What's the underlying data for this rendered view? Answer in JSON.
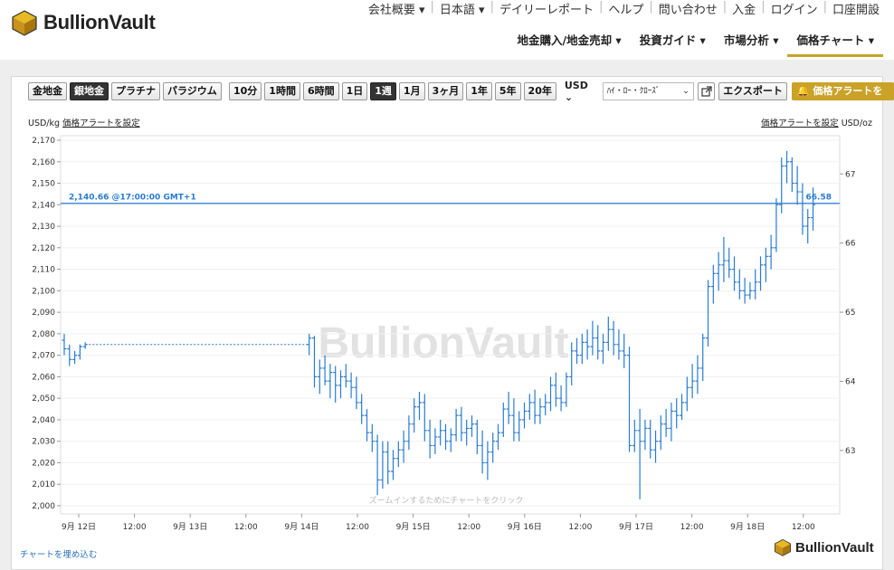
{
  "header": {
    "logo_text": "BullionVault",
    "top_links": [
      "会社概要 ▾",
      "日本語 ▾",
      "デイリーレポート",
      "ヘルプ",
      "問い合わせ",
      "入金",
      "ログイン",
      "口座開設"
    ],
    "nav": [
      {
        "label": "地金購入/地金売却 ▾",
        "active": false
      },
      {
        "label": "投資ガイド ▾",
        "active": false
      },
      {
        "label": "市場分析 ▾",
        "active": false
      },
      {
        "label": "価格チャート ▾",
        "active": true
      }
    ]
  },
  "toolbar": {
    "metals": [
      {
        "label": "金地金",
        "selected": false
      },
      {
        "label": "銀地金",
        "selected": true
      },
      {
        "label": "プラチナ",
        "selected": false
      },
      {
        "label": "パラジウム",
        "selected": false
      }
    ],
    "ranges": [
      {
        "label": "10分",
        "selected": false
      },
      {
        "label": "1時間",
        "selected": false
      },
      {
        "label": "6時間",
        "selected": false
      },
      {
        "label": "1日",
        "selected": false
      },
      {
        "label": "1週",
        "selected": true
      },
      {
        "label": "1月",
        "selected": false
      },
      {
        "label": "3ヶ月",
        "selected": false
      },
      {
        "label": "1年",
        "selected": false
      },
      {
        "label": "5年",
        "selected": false
      },
      {
        "label": "20年",
        "selected": false
      }
    ],
    "currency": "USD",
    "chart_style": "ﾊｲ・ﾛｰ・ｸﾛｰｽﾞ",
    "export_label": "エクスポート",
    "alert_label": "価格アラートを設定"
  },
  "units": {
    "left_unit": "USD/kg",
    "left_link": "価格アラートを設定",
    "right_link": "価格アラートを設定",
    "right_unit": "USD/oz"
  },
  "embed_label": "チャートを埋め込む",
  "footer_logo": "BullionVault",
  "colors": {
    "accent": "#c9a227",
    "series": "#2a7bd4",
    "dark": "#333333"
  },
  "chart_data": {
    "type": "ohlc",
    "watermark": "BullionVault",
    "zoom_hint": "ズームインするためにチャートをクリック",
    "current_label": "2,140.66 @17:00:00 GMT+1",
    "current_value": 2140.66,
    "current_value_oz": "66.58",
    "ylim": [
      2000,
      2170
    ],
    "yticks": [
      "2,000",
      "2,010",
      "2,020",
      "2,030",
      "2,040",
      "2,050",
      "2,060",
      "2,070",
      "2,080",
      "2,090",
      "2,100",
      "2,110",
      "2,120",
      "2,130",
      "2,140",
      "2,150",
      "2,160",
      "2,170"
    ],
    "yticks_right": [
      "63",
      "64",
      "65",
      "66",
      "67"
    ],
    "xticks": [
      "9月 12日",
      "12:00",
      "9月 13日",
      "12:00",
      "9月 14日",
      "12:00",
      "9月 15日",
      "12:00",
      "9月 16日",
      "12:00",
      "9月 17日",
      "12:00",
      "9月 18日",
      "12:00"
    ],
    "series": [
      {
        "name": "",
        "color": "#2a7bd4",
        "data": [
          [
            0.0,
            2077,
            2080,
            2070,
            2073
          ],
          [
            0.15,
            2073,
            2075,
            2065,
            2068
          ],
          [
            0.3,
            2068,
            2072,
            2066,
            2070
          ],
          [
            0.45,
            2070,
            2075,
            2068,
            2074
          ],
          [
            0.6,
            2074,
            2076,
            2073,
            2075
          ],
          [
            7.0,
            2075,
            2080,
            2070,
            2078
          ],
          [
            7.15,
            2078,
            2079,
            2055,
            2060
          ],
          [
            7.3,
            2060,
            2068,
            2052,
            2064
          ],
          [
            7.45,
            2064,
            2070,
            2056,
            2058
          ],
          [
            7.6,
            2058,
            2066,
            2050,
            2062
          ],
          [
            7.75,
            2062,
            2065,
            2048,
            2056
          ],
          [
            7.9,
            2056,
            2063,
            2050,
            2060
          ],
          [
            8.05,
            2060,
            2066,
            2055,
            2058
          ],
          [
            8.2,
            2058,
            2062,
            2050,
            2055
          ],
          [
            8.35,
            2055,
            2060,
            2045,
            2048
          ],
          [
            8.5,
            2048,
            2052,
            2038,
            2042
          ],
          [
            8.65,
            2042,
            2045,
            2030,
            2034
          ],
          [
            8.8,
            2034,
            2038,
            2025,
            2030
          ],
          [
            8.95,
            2030,
            2033,
            2005,
            2012
          ],
          [
            9.1,
            2012,
            2030,
            2008,
            2025
          ],
          [
            9.25,
            2025,
            2030,
            2010,
            2016
          ],
          [
            9.4,
            2016,
            2026,
            2012,
            2022
          ],
          [
            9.55,
            2022,
            2030,
            2018,
            2026
          ],
          [
            9.7,
            2026,
            2035,
            2020,
            2030
          ],
          [
            9.85,
            2030,
            2042,
            2026,
            2038
          ],
          [
            10.0,
            2038,
            2050,
            2034,
            2046
          ],
          [
            10.15,
            2046,
            2053,
            2040,
            2048
          ],
          [
            10.3,
            2048,
            2052,
            2030,
            2035
          ],
          [
            10.45,
            2035,
            2040,
            2022,
            2028
          ],
          [
            10.6,
            2028,
            2036,
            2024,
            2032
          ],
          [
            10.75,
            2032,
            2040,
            2028,
            2035
          ],
          [
            10.9,
            2035,
            2038,
            2026,
            2030
          ],
          [
            11.05,
            2030,
            2036,
            2025,
            2033
          ],
          [
            11.2,
            2033,
            2045,
            2030,
            2042
          ],
          [
            11.35,
            2042,
            2046,
            2030,
            2034
          ],
          [
            11.5,
            2034,
            2040,
            2028,
            2036
          ],
          [
            11.65,
            2036,
            2042,
            2032,
            2038
          ],
          [
            11.8,
            2038,
            2040,
            2024,
            2028
          ],
          [
            11.95,
            2028,
            2035,
            2015,
            2020
          ],
          [
            12.1,
            2020,
            2030,
            2012,
            2025
          ],
          [
            12.25,
            2025,
            2034,
            2020,
            2030
          ],
          [
            12.4,
            2030,
            2038,
            2026,
            2034
          ],
          [
            12.55,
            2034,
            2048,
            2032,
            2045
          ],
          [
            12.7,
            2045,
            2053,
            2038,
            2042
          ],
          [
            12.85,
            2042,
            2050,
            2030,
            2034
          ],
          [
            13.0,
            2034,
            2044,
            2030,
            2040
          ],
          [
            13.15,
            2040,
            2048,
            2036,
            2044
          ],
          [
            13.3,
            2044,
            2052,
            2040,
            2048
          ],
          [
            13.45,
            2048,
            2054,
            2038,
            2042
          ],
          [
            13.6,
            2042,
            2050,
            2038,
            2046
          ],
          [
            13.75,
            2046,
            2052,
            2042,
            2048
          ],
          [
            13.9,
            2048,
            2060,
            2044,
            2056
          ],
          [
            14.05,
            2056,
            2062,
            2046,
            2050
          ],
          [
            14.2,
            2050,
            2056,
            2044,
            2048
          ],
          [
            14.35,
            2048,
            2062,
            2046,
            2060
          ],
          [
            14.5,
            2060,
            2076,
            2056,
            2072
          ],
          [
            14.65,
            2072,
            2078,
            2066,
            2070
          ],
          [
            14.8,
            2070,
            2080,
            2066,
            2076
          ],
          [
            14.95,
            2076,
            2082,
            2068,
            2074
          ],
          [
            15.1,
            2074,
            2086,
            2070,
            2078
          ],
          [
            15.25,
            2078,
            2084,
            2068,
            2072
          ],
          [
            15.4,
            2072,
            2080,
            2066,
            2076
          ],
          [
            15.55,
            2076,
            2088,
            2072,
            2082
          ],
          [
            15.7,
            2082,
            2086,
            2070,
            2075
          ],
          [
            15.85,
            2075,
            2082,
            2068,
            2072
          ],
          [
            16.0,
            2072,
            2080,
            2064,
            2070
          ],
          [
            16.15,
            2070,
            2074,
            2025,
            2028
          ],
          [
            16.3,
            2028,
            2040,
            2025,
            2035
          ],
          [
            16.45,
            2035,
            2045,
            2003,
            2030
          ],
          [
            16.6,
            2030,
            2040,
            2026,
            2036
          ],
          [
            16.75,
            2036,
            2040,
            2022,
            2026
          ],
          [
            16.9,
            2026,
            2035,
            2020,
            2030
          ],
          [
            17.05,
            2030,
            2042,
            2026,
            2038
          ],
          [
            17.2,
            2038,
            2045,
            2032,
            2036
          ],
          [
            17.35,
            2036,
            2048,
            2030,
            2044
          ],
          [
            17.5,
            2044,
            2050,
            2036,
            2042
          ],
          [
            17.65,
            2042,
            2052,
            2040,
            2048
          ],
          [
            17.8,
            2048,
            2060,
            2044,
            2055
          ],
          [
            17.95,
            2055,
            2066,
            2050,
            2058
          ],
          [
            18.1,
            2058,
            2070,
            2052,
            2064
          ],
          [
            18.25,
            2064,
            2080,
            2058,
            2078
          ],
          [
            18.4,
            2078,
            2105,
            2074,
            2102
          ],
          [
            18.55,
            2102,
            2112,
            2094,
            2108
          ],
          [
            18.7,
            2108,
            2118,
            2100,
            2112
          ],
          [
            18.85,
            2112,
            2125,
            2104,
            2114
          ],
          [
            19.0,
            2114,
            2120,
            2106,
            2110
          ],
          [
            19.15,
            2110,
            2116,
            2100,
            2104
          ],
          [
            19.3,
            2104,
            2110,
            2096,
            2100
          ],
          [
            19.45,
            2100,
            2106,
            2094,
            2098
          ],
          [
            19.6,
            2098,
            2104,
            2096,
            2100
          ],
          [
            19.75,
            2100,
            2110,
            2096,
            2104
          ],
          [
            19.9,
            2104,
            2116,
            2100,
            2112
          ],
          [
            20.05,
            2112,
            2120,
            2104,
            2116
          ],
          [
            20.2,
            2116,
            2126,
            2110,
            2120
          ],
          [
            20.35,
            2120,
            2143,
            2118,
            2140
          ],
          [
            20.5,
            2140,
            2162,
            2136,
            2158
          ],
          [
            20.65,
            2158,
            2165,
            2150,
            2160
          ],
          [
            20.8,
            2160,
            2162,
            2146,
            2150
          ],
          [
            20.95,
            2150,
            2158,
            2140,
            2146
          ],
          [
            21.1,
            2146,
            2150,
            2126,
            2130
          ],
          [
            21.25,
            2130,
            2138,
            2122,
            2134
          ],
          [
            21.4,
            2134,
            2148,
            2128,
            2140
          ]
        ]
      }
    ]
  }
}
